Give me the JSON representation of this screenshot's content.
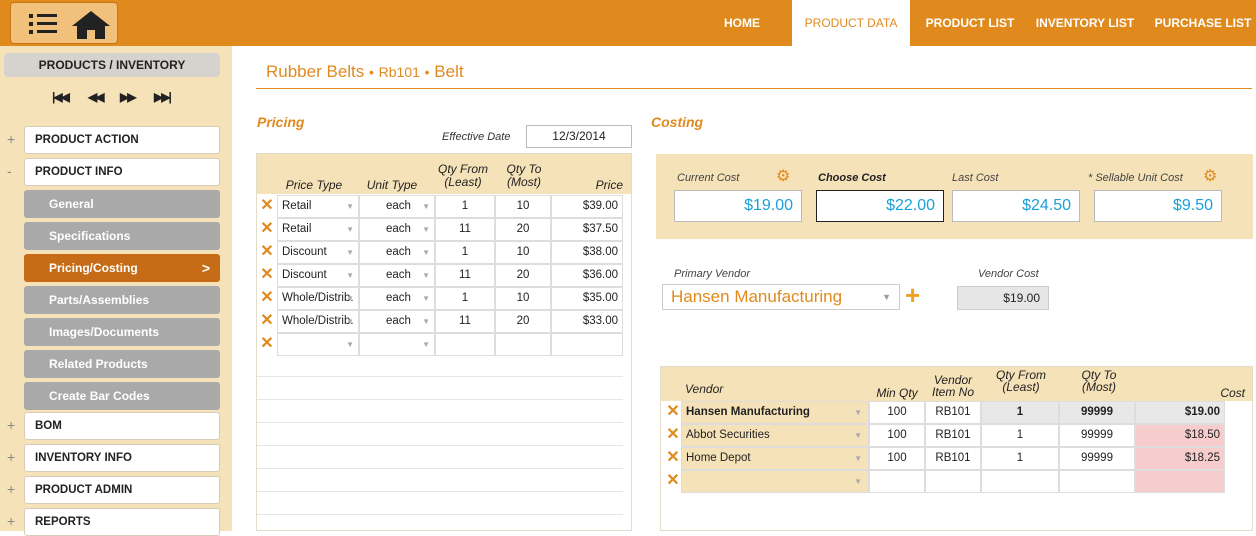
{
  "nav": {
    "menu_icon": "hamburger-icon",
    "home_icon": "home-icon",
    "links": [
      "HOME",
      "PRODUCT DATA",
      "PRODUCT LIST",
      "INVENTORY LIST",
      "PURCHASE LIST"
    ],
    "active": "PRODUCT DATA",
    "accent": "#e08a1e"
  },
  "sidebar": {
    "heading": "PRODUCTS / INVENTORY",
    "record_nav": [
      "first-record-icon",
      "prev-record-icon",
      "next-record-icon",
      "last-record-icon"
    ],
    "groups": [
      {
        "pm": "+",
        "label": "PRODUCT ACTION"
      },
      {
        "pm": "-",
        "label": "PRODUCT INFO"
      }
    ],
    "subitems": [
      "General",
      "Specifications",
      "Pricing/Costing",
      "Parts/Assemblies",
      "Images/Documents",
      "Related Products",
      "Create Bar Codes"
    ],
    "active_sub": "Pricing/Costing",
    "groups_after": [
      {
        "pm": "+",
        "label": "BOM"
      },
      {
        "pm": "+",
        "label": "INVENTORY INFO"
      },
      {
        "pm": "+",
        "label": "PRODUCT ADMIN"
      },
      {
        "pm": "+",
        "label": "REPORTS"
      }
    ]
  },
  "header": {
    "product_name": "Rubber Belts",
    "sku": "Rb101",
    "category": "Belt",
    "separator": "•"
  },
  "pricing": {
    "title": "Pricing",
    "effective_date_label": "Effective Date",
    "effective_date": "12/3/2014",
    "columns": {
      "price_type": "Price Type",
      "unit_type": "Unit Type",
      "qty_from_1": "Qty From",
      "qty_from_2": "(Least)",
      "qty_to_1": "Qty To",
      "qty_to_2": "(Most)",
      "price": "Price"
    },
    "rows": [
      {
        "price_type": "Retail",
        "unit": "each",
        "from": "1",
        "to": "10",
        "price": "$39.00"
      },
      {
        "price_type": "Retail",
        "unit": "each",
        "from": "11",
        "to": "20",
        "price": "$37.50"
      },
      {
        "price_type": "Discount",
        "unit": "each",
        "from": "1",
        "to": "10",
        "price": "$38.00"
      },
      {
        "price_type": "Discount",
        "unit": "each",
        "from": "11",
        "to": "20",
        "price": "$36.00"
      },
      {
        "price_type": "Whole/Distrib.",
        "unit": "each",
        "from": "1",
        "to": "10",
        "price": "$35.00"
      },
      {
        "price_type": "Whole/Distrib.",
        "unit": "each",
        "from": "11",
        "to": "20",
        "price": "$33.00"
      },
      {
        "price_type": "",
        "unit": "",
        "from": "",
        "to": "",
        "price": ""
      }
    ]
  },
  "costing": {
    "title": "Costing",
    "current_cost_label": "Current Cost",
    "current_cost": "$19.00",
    "choose_cost_label": "Choose Cost",
    "choose_cost": "$22.00",
    "last_cost_label": "Last Cost",
    "last_cost": "$24.50",
    "sellable_unit_cost_label": "* Sellable Unit Cost",
    "sellable_unit_cost": "$9.50",
    "primary_vendor_label": "Primary Vendor",
    "primary_vendor": "Hansen Manufacturing",
    "vendor_cost_label": "Vendor Cost",
    "vendor_cost": "$19.00",
    "value_color": "#1aa0d8"
  },
  "vendors": {
    "columns": {
      "vendor": "Vendor",
      "min_qty": "Min Qty",
      "item_no_1": "Vendor",
      "item_no_2": "Item No",
      "qty_from_1": "Qty From",
      "qty_from_2": "(Least)",
      "qty_to_1": "Qty To",
      "qty_to_2": "(Most)",
      "cost": "Cost"
    },
    "rows": [
      {
        "vendor": "Hansen Manufacturing",
        "min_qty": "100",
        "item_no": "RB101",
        "from": "1",
        "to": "99999",
        "cost": "$19.00"
      },
      {
        "vendor": "Abbot Securities",
        "min_qty": "100",
        "item_no": "RB101",
        "from": "1",
        "to": "99999",
        "cost": "$18.50"
      },
      {
        "vendor": "Home Depot",
        "min_qty": "100",
        "item_no": "RB101",
        "from": "1",
        "to": "99999",
        "cost": "$18.25"
      },
      {
        "vendor": "",
        "min_qty": "",
        "item_no": "",
        "from": "",
        "to": "",
        "cost": ""
      }
    ]
  }
}
